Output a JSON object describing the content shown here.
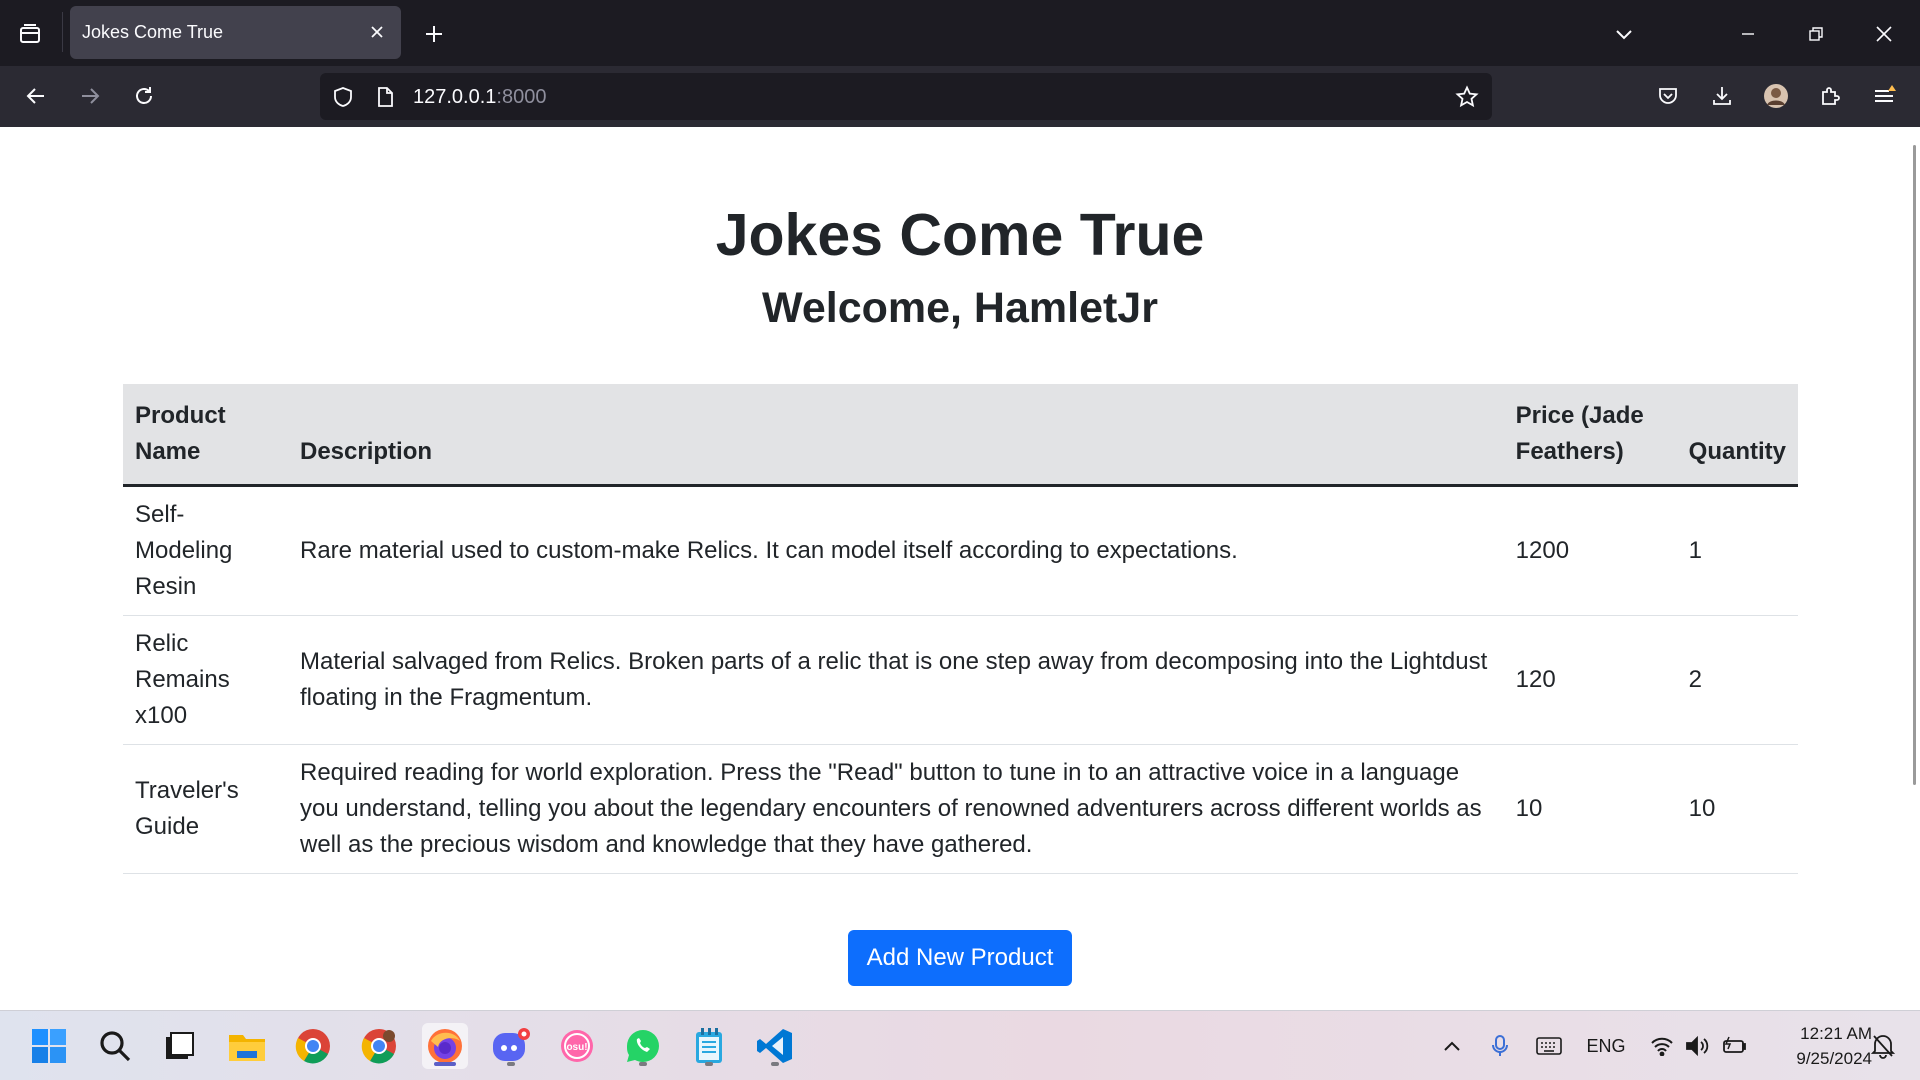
{
  "browser": {
    "tab_title": "Jokes Come True",
    "url_host": "127.0.0.1",
    "url_port": ":8000"
  },
  "page": {
    "title": "Jokes Come True",
    "welcome": "Welcome, HamletJr",
    "table": {
      "headers": {
        "name_line1": "Product",
        "name_line2": "Name",
        "description": "Description",
        "price_line1": "Price (Jade",
        "price_line2": "Feathers)",
        "quantity": "Quantity"
      },
      "rows": [
        {
          "name": "Self-Modeling Resin",
          "description": "Rare material used to custom-make Relics. It can model itself according to expectations.",
          "price": "1200",
          "quantity": "1"
        },
        {
          "name": "Relic Remains x100",
          "description": "Material salvaged from Relics. Broken parts of a relic that is one step away from decomposing into the Lightdust floating in the Fragmentum.",
          "price": "120",
          "quantity": "2"
        },
        {
          "name": "Traveler's Guide",
          "description": "Required reading for world exploration. Press the \"Read\" button to tune in to an attractive voice in a language you understand, telling you about the legendary encounters of renowned adventurers across different worlds as well as the precious wisdom and knowledge that they have gathered.",
          "price": "10",
          "quantity": "10"
        }
      ]
    },
    "add_button_label": "Add New Product"
  },
  "taskbar": {
    "apps": [
      "start-icon",
      "search-icon",
      "task-view-icon",
      "file-explorer-icon",
      "chrome-icon",
      "chrome-alt-icon",
      "firefox-icon",
      "discord-icon",
      "osu-icon",
      "whatsapp-icon",
      "notepad-icon",
      "vscode-icon"
    ],
    "osu_label": "osu!",
    "language": "ENG",
    "time": "12:21 AM",
    "date": "9/25/2024"
  },
  "colors": {
    "primary_button": "#0d6efd",
    "table_header_bg": "#e2e3e5",
    "tab_bar_bg": "#1c1b22",
    "nav_bar_bg": "#2b2a33"
  }
}
